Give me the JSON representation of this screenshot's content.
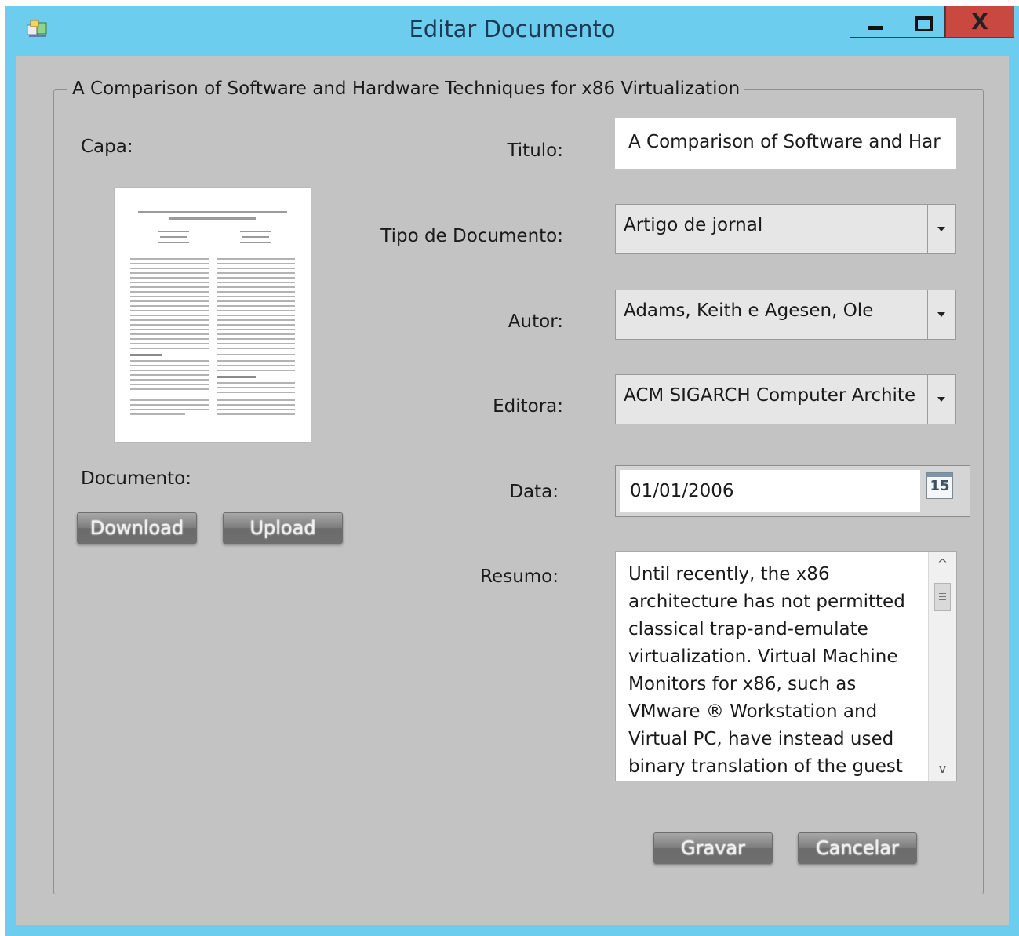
{
  "window": {
    "title": "Editar Documento",
    "close_glyph": "X"
  },
  "group": {
    "header": "A Comparison of Software and Hardware Techniques for x86 Virtualization"
  },
  "labels": {
    "capa": "Capa:",
    "documento": "Documento:",
    "titulo": "Titulo:",
    "tipo": "Tipo de Documento:",
    "autor": "Autor:",
    "editora": "Editora:",
    "data": "Data:",
    "resumo": "Resumo:"
  },
  "fields": {
    "titulo": "A Comparison of Software and Har",
    "tipo": "Artigo de jornal",
    "autor": "Adams, Keith e Agesen, Ole",
    "editora": "ACM SIGARCH Computer Archite",
    "data": "01/01/2006",
    "calendar_day": "15",
    "resumo": "Until recently, the x86 architecture has not permitted classical trap-and-emulate virtualization. Virtual Machine Monitors for x86, such as VMware ® Workstation and Virtual PC, have instead used binary translation of the guest"
  },
  "buttons": {
    "download": "Download",
    "upload": "Upload",
    "gravar": "Gravar",
    "cancelar": "Cancelar"
  },
  "scrollbar": {
    "up": "^",
    "down": "v"
  },
  "icons": {
    "app": "app-icon",
    "minimize": "minimize-icon",
    "maximize": "maximize-icon",
    "close": "close-icon",
    "dropdown": "chevron-down-icon",
    "calendar": "calendar-icon"
  },
  "colors": {
    "titlebar": "#6ccdee",
    "client": "#c3c3c3",
    "close_button": "#c9483f"
  }
}
